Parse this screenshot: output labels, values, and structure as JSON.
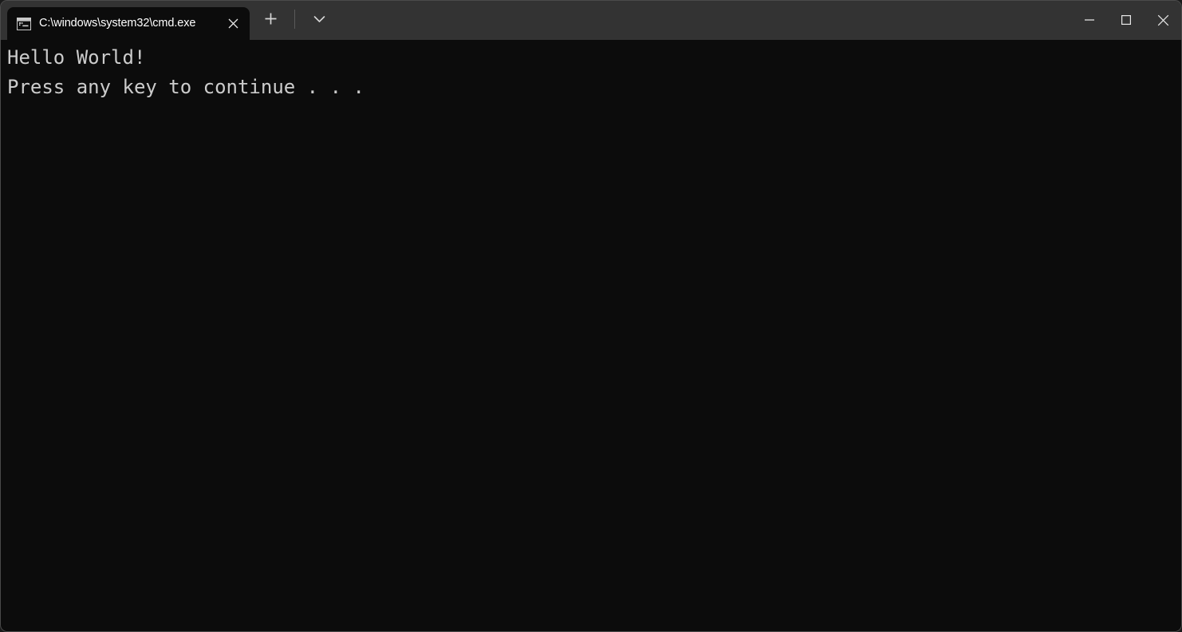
{
  "window": {
    "titlebar_bg": "#333333",
    "console_bg": "#0c0c0c",
    "console_fg": "#cccccc",
    "border_color": "#4a4a4a"
  },
  "tabs": [
    {
      "title": "C:\\windows\\system32\\cmd.exe",
      "icon": "console-icon",
      "close_label": "✕",
      "active": true
    }
  ],
  "tabbar": {
    "new_tab_label": "+",
    "new_tab_icon": "plus-icon",
    "dropdown_icon": "chevron-down-icon"
  },
  "window_controls": {
    "minimize": "─",
    "maximize": "☐",
    "close": "✕",
    "minimize_icon": "minimize-icon",
    "maximize_icon": "maximize-icon",
    "close_icon": "close-icon"
  },
  "console": {
    "lines": [
      "Hello World!",
      "Press any key to continue . . ."
    ]
  }
}
